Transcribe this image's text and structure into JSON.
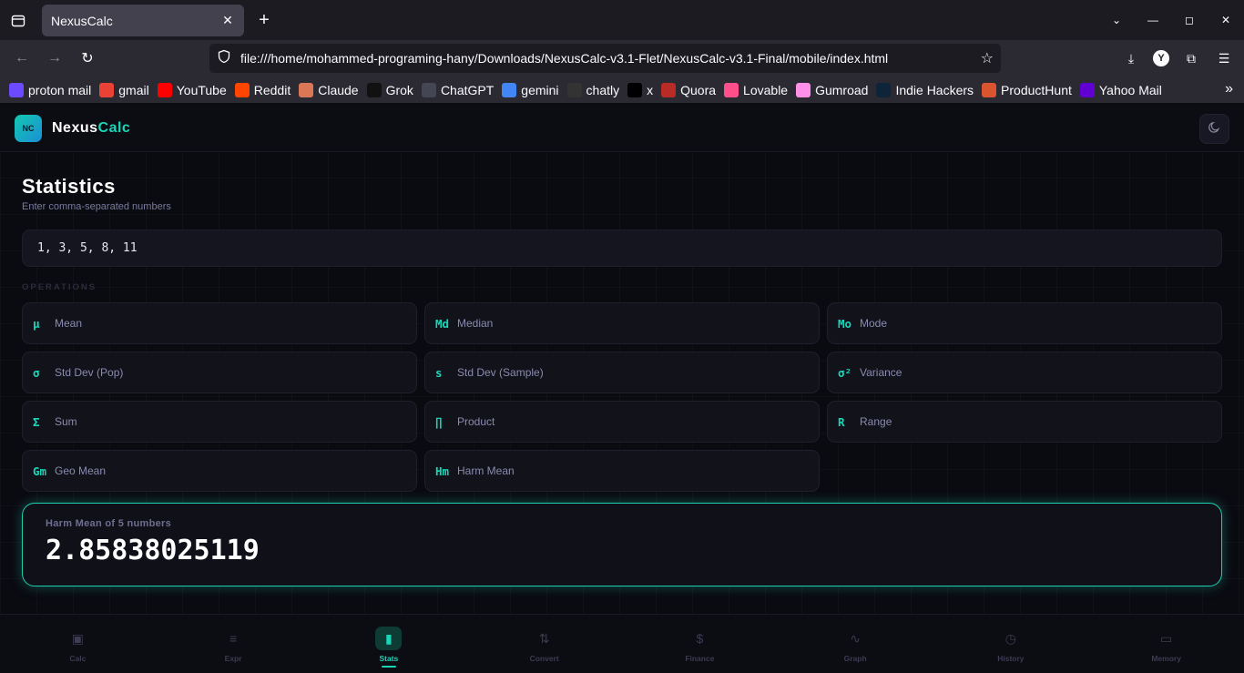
{
  "browser": {
    "tab_title": "NexusCalc",
    "url": "file:///home/mohammed-programing-hany/Downloads/NexusCalc-v3.1-Flet/NexusCalc-v3.1-Final/mobile/index.html",
    "profile_initial": "Y",
    "bookmarks": [
      {
        "label": "proton mail",
        "icon": "proton-mail-icon",
        "color": "#6d4aff"
      },
      {
        "label": "gmail",
        "icon": "gmail-icon",
        "color": "#ea4335"
      },
      {
        "label": "YouTube",
        "icon": "youtube-icon",
        "color": "#ff0000"
      },
      {
        "label": "Reddit",
        "icon": "reddit-icon",
        "color": "#ff4500"
      },
      {
        "label": "Claude",
        "icon": "claude-icon",
        "color": "#d97757"
      },
      {
        "label": "Grok",
        "icon": "grok-icon",
        "color": "#111111"
      },
      {
        "label": "ChatGPT",
        "icon": "chatgpt-icon",
        "color": "#444654"
      },
      {
        "label": "gemini",
        "icon": "gemini-icon",
        "color": "#4285f4"
      },
      {
        "label": "chatly",
        "icon": "chatly-icon",
        "color": "#333333"
      },
      {
        "label": "x",
        "icon": "x-icon",
        "color": "#000000"
      },
      {
        "label": "Quora",
        "icon": "quora-icon",
        "color": "#b92b27"
      },
      {
        "label": "Lovable",
        "icon": "lovable-icon",
        "color": "#ff4f8b"
      },
      {
        "label": "Gumroad",
        "icon": "gumroad-icon",
        "color": "#ff90e8"
      },
      {
        "label": "Indie Hackers",
        "icon": "indie-hackers-icon",
        "color": "#0e2439"
      },
      {
        "label": "ProductHunt",
        "icon": "producthunt-icon",
        "color": "#da552f"
      },
      {
        "label": "Yahoo Mail",
        "icon": "yahoo-mail-icon",
        "color": "#6001d2"
      }
    ]
  },
  "app": {
    "logo_text": "NC",
    "brand_part1": "Nexus",
    "brand_part2": "Calc",
    "theme_icon": "moon-icon",
    "accent_color": "#19d6b8"
  },
  "stats": {
    "title": "Statistics",
    "subtitle": "Enter comma-separated numbers",
    "input_value": "1, 3, 5, 8, 11",
    "operations_label": "OPERATIONS",
    "operations": [
      {
        "symbol": "μ",
        "label": "Mean"
      },
      {
        "symbol": "Md",
        "label": "Median"
      },
      {
        "symbol": "Mo",
        "label": "Mode"
      },
      {
        "symbol": "σ",
        "label": "Std Dev (Pop)"
      },
      {
        "symbol": "s",
        "label": "Std Dev (Sample)"
      },
      {
        "symbol": "σ²",
        "label": "Variance"
      },
      {
        "symbol": "Σ",
        "label": "Sum"
      },
      {
        "symbol": "∏",
        "label": "Product"
      },
      {
        "symbol": "R",
        "label": "Range"
      },
      {
        "symbol": "Gm",
        "label": "Geo Mean"
      },
      {
        "symbol": "Hm",
        "label": "Harm Mean"
      }
    ],
    "result_label": "Harm Mean of 5 numbers",
    "result_value": "2.85838025119"
  },
  "bottom_nav": [
    {
      "label": "Calc",
      "icon": "calculator-icon",
      "glyph": "▣",
      "active": false
    },
    {
      "label": "Expr",
      "icon": "expression-icon",
      "glyph": "≡",
      "active": false
    },
    {
      "label": "Stats",
      "icon": "bar-chart-icon",
      "glyph": "▮",
      "active": true
    },
    {
      "label": "Convert",
      "icon": "convert-arrows-icon",
      "glyph": "⇅",
      "active": false
    },
    {
      "label": "Finance",
      "icon": "dollar-icon",
      "glyph": "$",
      "active": false
    },
    {
      "label": "Graph",
      "icon": "graph-icon",
      "glyph": "∿",
      "active": false
    },
    {
      "label": "History",
      "icon": "clock-icon",
      "glyph": "◷",
      "active": false
    },
    {
      "label": "Memory",
      "icon": "memory-icon",
      "glyph": "▭",
      "active": false
    }
  ]
}
